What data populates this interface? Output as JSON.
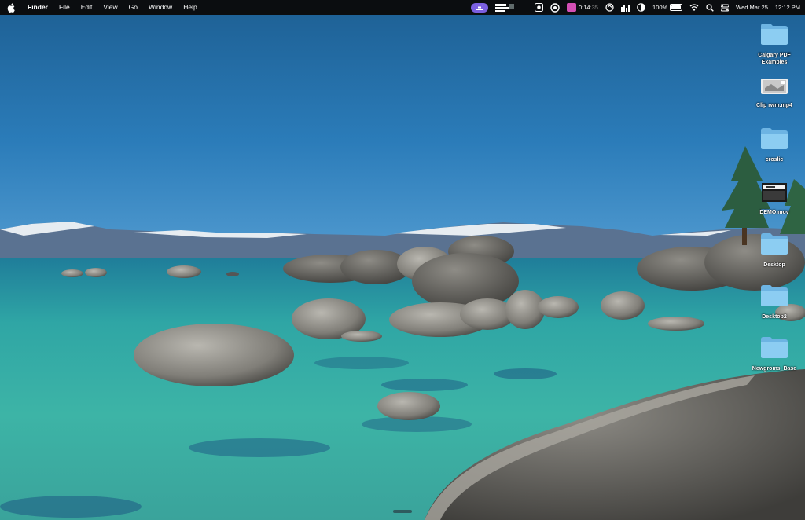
{
  "menubar": {
    "items": [
      "Finder",
      "File",
      "Edit",
      "View",
      "Go",
      "Window",
      "Help"
    ],
    "timer": "0:14",
    "timer_dim": ":35",
    "battery_percent": "100%",
    "battery_level": 1.0,
    "datetime_date": "Wed Mar 25",
    "datetime_time": "12:12 PM"
  },
  "desktop": {
    "items": [
      {
        "label": "Calgary PDF\nExamples",
        "kind": "folder",
        "icon": "folder-icon"
      },
      {
        "label": "Clip rwm.mp4",
        "kind": "video",
        "icon": "video-thumbnail-icon"
      },
      {
        "label": "croslic",
        "kind": "folder",
        "icon": "folder-icon"
      },
      {
        "label": "DEMO.mov",
        "kind": "video",
        "icon": "video-thumbnail-icon"
      },
      {
        "label": "Desktop",
        "kind": "folder",
        "icon": "folder-icon"
      },
      {
        "label": "Desktop2",
        "kind": "folder",
        "icon": "folder-icon"
      },
      {
        "label": "Newgroms_Base",
        "kind": "folder",
        "icon": "folder-icon"
      }
    ]
  },
  "colors": {
    "menubar_bg": "#0b0d10",
    "folder_blue": "#7cc0ea",
    "sky_top": "#1f6ea5",
    "water": "#2fa6a5"
  },
  "icons": [
    "apple-logo-icon",
    "screen-record-icon",
    "screen-share-icon",
    "camera-icon",
    "color-wheel-icon",
    "timer-icon",
    "sync-icon",
    "chart-icon",
    "contrast-icon",
    "battery-icon",
    "wifi-icon",
    "search-icon",
    "control-center-icon"
  ]
}
